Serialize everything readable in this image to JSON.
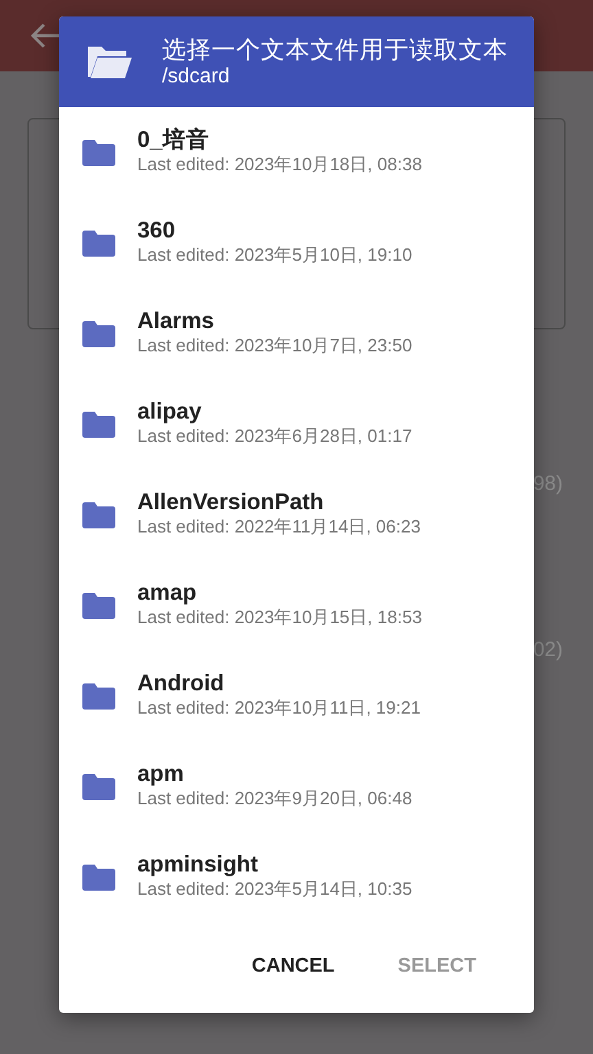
{
  "background": {
    "fragments": [
      "98)",
      "02)"
    ]
  },
  "dialog": {
    "title": "选择一个文本文件用于读取文本",
    "path": "/sdcard",
    "items": [
      {
        "name": "0_培音",
        "edited": "Last edited: 2023年10月18日, 08:38"
      },
      {
        "name": "360",
        "edited": "Last edited: 2023年5月10日, 19:10"
      },
      {
        "name": "Alarms",
        "edited": "Last edited: 2023年10月7日, 23:50"
      },
      {
        "name": "alipay",
        "edited": "Last edited: 2023年6月28日, 01:17"
      },
      {
        "name": "AllenVersionPath",
        "edited": "Last edited: 2022年11月14日, 06:23"
      },
      {
        "name": "amap",
        "edited": "Last edited: 2023年10月15日, 18:53"
      },
      {
        "name": "Android",
        "edited": "Last edited: 2023年10月11日, 19:21"
      },
      {
        "name": "apm",
        "edited": "Last edited: 2023年9月20日, 06:48"
      },
      {
        "name": "apminsight",
        "edited": "Last edited: 2023年5月14日, 10:35"
      }
    ],
    "buttons": [
      {
        "label": "CANCEL",
        "disabled": false
      },
      {
        "label": "SELECT",
        "disabled": true
      }
    ]
  }
}
